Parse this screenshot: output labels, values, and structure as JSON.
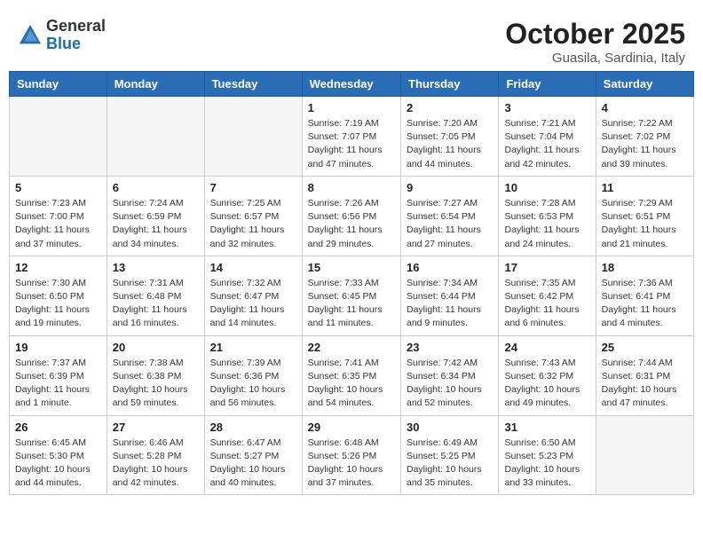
{
  "header": {
    "logo_general": "General",
    "logo_blue": "Blue",
    "month_title": "October 2025",
    "subtitle": "Guasila, Sardinia, Italy"
  },
  "days_of_week": [
    "Sunday",
    "Monday",
    "Tuesday",
    "Wednesday",
    "Thursday",
    "Friday",
    "Saturday"
  ],
  "weeks": [
    [
      {
        "day": "",
        "info": ""
      },
      {
        "day": "",
        "info": ""
      },
      {
        "day": "",
        "info": ""
      },
      {
        "day": "1",
        "info": "Sunrise: 7:19 AM\nSunset: 7:07 PM\nDaylight: 11 hours and 47 minutes."
      },
      {
        "day": "2",
        "info": "Sunrise: 7:20 AM\nSunset: 7:05 PM\nDaylight: 11 hours and 44 minutes."
      },
      {
        "day": "3",
        "info": "Sunrise: 7:21 AM\nSunset: 7:04 PM\nDaylight: 11 hours and 42 minutes."
      },
      {
        "day": "4",
        "info": "Sunrise: 7:22 AM\nSunset: 7:02 PM\nDaylight: 11 hours and 39 minutes."
      }
    ],
    [
      {
        "day": "5",
        "info": "Sunrise: 7:23 AM\nSunset: 7:00 PM\nDaylight: 11 hours and 37 minutes."
      },
      {
        "day": "6",
        "info": "Sunrise: 7:24 AM\nSunset: 6:59 PM\nDaylight: 11 hours and 34 minutes."
      },
      {
        "day": "7",
        "info": "Sunrise: 7:25 AM\nSunset: 6:57 PM\nDaylight: 11 hours and 32 minutes."
      },
      {
        "day": "8",
        "info": "Sunrise: 7:26 AM\nSunset: 6:56 PM\nDaylight: 11 hours and 29 minutes."
      },
      {
        "day": "9",
        "info": "Sunrise: 7:27 AM\nSunset: 6:54 PM\nDaylight: 11 hours and 27 minutes."
      },
      {
        "day": "10",
        "info": "Sunrise: 7:28 AM\nSunset: 6:53 PM\nDaylight: 11 hours and 24 minutes."
      },
      {
        "day": "11",
        "info": "Sunrise: 7:29 AM\nSunset: 6:51 PM\nDaylight: 11 hours and 21 minutes."
      }
    ],
    [
      {
        "day": "12",
        "info": "Sunrise: 7:30 AM\nSunset: 6:50 PM\nDaylight: 11 hours and 19 minutes."
      },
      {
        "day": "13",
        "info": "Sunrise: 7:31 AM\nSunset: 6:48 PM\nDaylight: 11 hours and 16 minutes."
      },
      {
        "day": "14",
        "info": "Sunrise: 7:32 AM\nSunset: 6:47 PM\nDaylight: 11 hours and 14 minutes."
      },
      {
        "day": "15",
        "info": "Sunrise: 7:33 AM\nSunset: 6:45 PM\nDaylight: 11 hours and 11 minutes."
      },
      {
        "day": "16",
        "info": "Sunrise: 7:34 AM\nSunset: 6:44 PM\nDaylight: 11 hours and 9 minutes."
      },
      {
        "day": "17",
        "info": "Sunrise: 7:35 AM\nSunset: 6:42 PM\nDaylight: 11 hours and 6 minutes."
      },
      {
        "day": "18",
        "info": "Sunrise: 7:36 AM\nSunset: 6:41 PM\nDaylight: 11 hours and 4 minutes."
      }
    ],
    [
      {
        "day": "19",
        "info": "Sunrise: 7:37 AM\nSunset: 6:39 PM\nDaylight: 11 hours and 1 minute."
      },
      {
        "day": "20",
        "info": "Sunrise: 7:38 AM\nSunset: 6:38 PM\nDaylight: 10 hours and 59 minutes."
      },
      {
        "day": "21",
        "info": "Sunrise: 7:39 AM\nSunset: 6:36 PM\nDaylight: 10 hours and 56 minutes."
      },
      {
        "day": "22",
        "info": "Sunrise: 7:41 AM\nSunset: 6:35 PM\nDaylight: 10 hours and 54 minutes."
      },
      {
        "day": "23",
        "info": "Sunrise: 7:42 AM\nSunset: 6:34 PM\nDaylight: 10 hours and 52 minutes."
      },
      {
        "day": "24",
        "info": "Sunrise: 7:43 AM\nSunset: 6:32 PM\nDaylight: 10 hours and 49 minutes."
      },
      {
        "day": "25",
        "info": "Sunrise: 7:44 AM\nSunset: 6:31 PM\nDaylight: 10 hours and 47 minutes."
      }
    ],
    [
      {
        "day": "26",
        "info": "Sunrise: 6:45 AM\nSunset: 5:30 PM\nDaylight: 10 hours and 44 minutes."
      },
      {
        "day": "27",
        "info": "Sunrise: 6:46 AM\nSunset: 5:28 PM\nDaylight: 10 hours and 42 minutes."
      },
      {
        "day": "28",
        "info": "Sunrise: 6:47 AM\nSunset: 5:27 PM\nDaylight: 10 hours and 40 minutes."
      },
      {
        "day": "29",
        "info": "Sunrise: 6:48 AM\nSunset: 5:26 PM\nDaylight: 10 hours and 37 minutes."
      },
      {
        "day": "30",
        "info": "Sunrise: 6:49 AM\nSunset: 5:25 PM\nDaylight: 10 hours and 35 minutes."
      },
      {
        "day": "31",
        "info": "Sunrise: 6:50 AM\nSunset: 5:23 PM\nDaylight: 10 hours and 33 minutes."
      },
      {
        "day": "",
        "info": ""
      }
    ]
  ]
}
